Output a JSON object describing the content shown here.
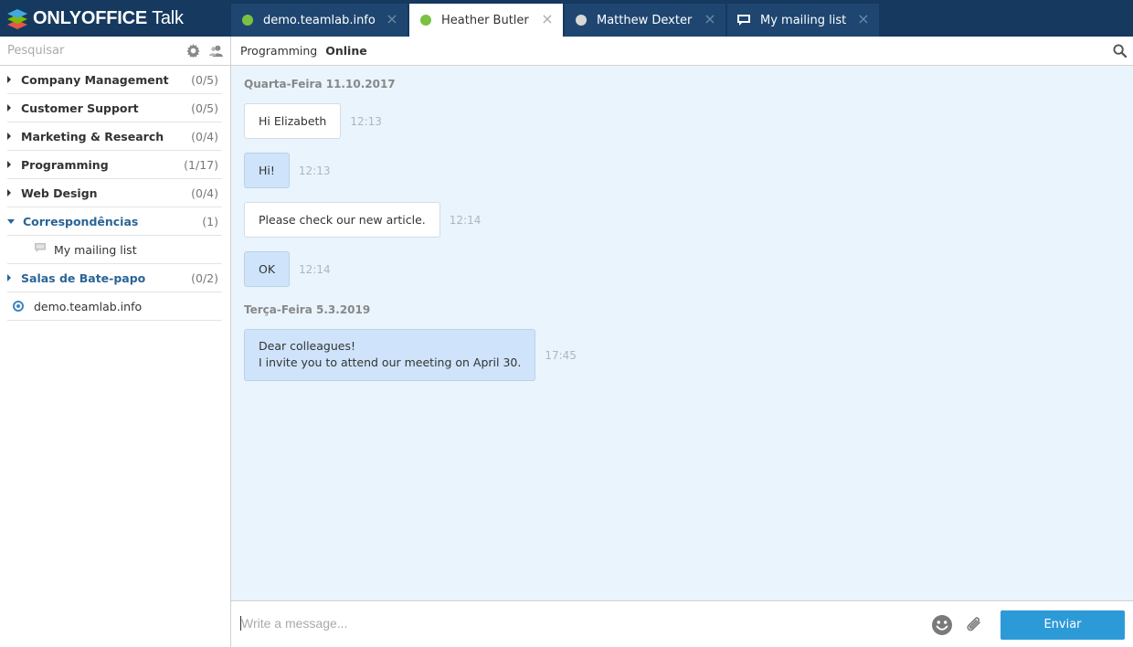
{
  "app": {
    "logo_brand": "ONLYOFFICE",
    "logo_product": "Talk"
  },
  "tabs": [
    {
      "label": "demo.teamlab.info",
      "status": "online",
      "icon": "green-status-dot"
    },
    {
      "label": "Heather Butler",
      "status": "online",
      "icon": "green-status-dot",
      "active": true
    },
    {
      "label": "Matthew Dexter",
      "status": "offline",
      "icon": "gray-status-dot"
    },
    {
      "label": "My mailing list",
      "icon": "mailing-list-icon"
    }
  ],
  "sidebar": {
    "search_placeholder": "Pesquisar",
    "groups": [
      {
        "name": "Company Management",
        "count": "(0/5)"
      },
      {
        "name": "Customer Support",
        "count": "(0/5)"
      },
      {
        "name": "Marketing & Research",
        "count": "(0/4)"
      },
      {
        "name": "Programming",
        "count": "(1/17)"
      },
      {
        "name": "Web Design",
        "count": "(0/4)"
      },
      {
        "name": "Correspondências",
        "count": "(1)",
        "expanded": true
      },
      {
        "name": "Salas de Bate-papo",
        "count": "(0/2)"
      }
    ],
    "mailing_item": "My mailing list",
    "server": "demo.teamlab.info"
  },
  "conversation": {
    "group": "Programming",
    "status": "Online",
    "dates": [
      "Quarta-Feira 11.10.2017",
      "Terça-Feira 5.3.2019"
    ],
    "messages": [
      {
        "text": "Hi Elizabeth",
        "time": "12:13",
        "direction": "in"
      },
      {
        "text": "Hi!",
        "time": "12:13",
        "direction": "out"
      },
      {
        "text": "Please check our new article.",
        "time": "12:14",
        "direction": "in"
      },
      {
        "text": "OK",
        "time": "12:14",
        "direction": "out"
      },
      {
        "line1": "Dear colleagues!",
        "line2": "I invite you to attend our meeting on April 30.",
        "time": "17:45",
        "direction": "out"
      }
    ]
  },
  "composer": {
    "placeholder": "Write a message...",
    "send_label": "Enviar"
  },
  "colors": {
    "topbar": "#15395f",
    "accent": "#2d9ad8",
    "chat_background": "#eaf4fd",
    "outgoing_bubble": "#cfe4fa"
  }
}
